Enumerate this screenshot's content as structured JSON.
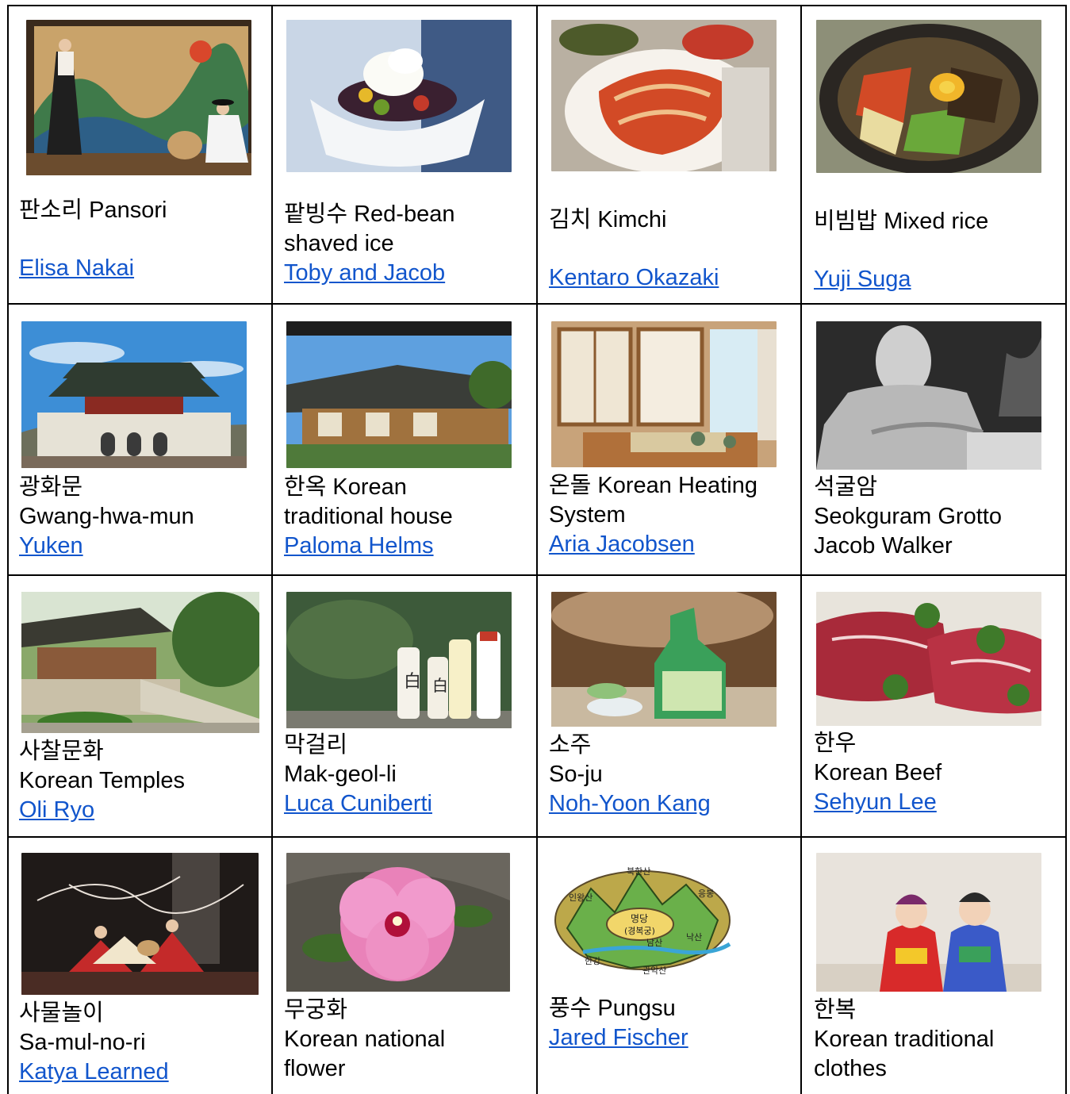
{
  "cells": [
    {
      "image": "pansori-performance-photo",
      "lines": [
        "판소리 Pansori"
      ],
      "credit": "Elisa Nakai",
      "credit_link": true
    },
    {
      "image": "patbingsu-dessert-photo",
      "lines": [
        "팥빙수 Red-bean",
        "shaved ice"
      ],
      "credit": "Toby and Jacob",
      "credit_link": true
    },
    {
      "image": "kimchi-plate-photo",
      "lines": [
        "김치  Kimchi"
      ],
      "credit": "Kentaro Okazaki",
      "credit_link": true
    },
    {
      "image": "bibimbap-bowl-photo",
      "lines": [
        "비빔밥 Mixed rice"
      ],
      "credit": "Yuji Suga",
      "credit_link": true
    },
    {
      "image": "gwanghwamun-gate-photo",
      "lines": [
        "광화문",
        "Gwang-hwa-mun"
      ],
      "credit": "Yuken",
      "credit_link": true
    },
    {
      "image": "hanok-house-photo",
      "lines": [
        "한옥 Korean",
        "traditional house"
      ],
      "credit": "Paloma Helms",
      "credit_link": true
    },
    {
      "image": "ondol-room-photo",
      "lines": [
        "온돌 Korean Heating",
        "System"
      ],
      "credit": "Aria Jacobsen",
      "credit_link": true
    },
    {
      "image": "seokguram-buddha-photo",
      "lines": [
        "석굴암",
        "Seokguram Grotto"
      ],
      "credit": "Jacob Walker",
      "credit_link": false
    },
    {
      "image": "korean-temple-photo",
      "lines": [
        "사찰문화",
        "Korean Temples"
      ],
      "credit": "Oli Ryo",
      "credit_link": true
    },
    {
      "image": "makgeolli-bottles-photo",
      "lines": [
        "막걸리",
        "Mak-geol-li"
      ],
      "credit": "Luca Cuniberti",
      "credit_link": true
    },
    {
      "image": "soju-bottle-photo",
      "lines": [
        "소주",
        "So-ju"
      ],
      "credit": "Noh-Yoon Kang",
      "credit_link": true
    },
    {
      "image": "hanwoo-beef-photo",
      "lines": [
        "한우",
        "Korean Beef"
      ],
      "credit": "Sehyun Lee",
      "credit_link": true
    },
    {
      "image": "samulnori-dancers-photo",
      "lines": [
        " 사물놀이",
        "Sa-mul-no-ri"
      ],
      "credit": "Katya Learned",
      "credit_link": true
    },
    {
      "image": "mugunghwa-flower-photo",
      "lines": [
        "무궁화",
        "Korean national",
        "flower"
      ],
      "credit": "",
      "credit_link": false
    },
    {
      "image": "pungsu-map-drawing",
      "lines": [
        "풍수 Pungsu"
      ],
      "credit": "Jared Fischer",
      "credit_link": true
    },
    {
      "image": "hanbok-babies-photo",
      "lines": [
        "한복",
        "Korean traditional",
        "clothes"
      ],
      "credit": "",
      "credit_link": false
    }
  ],
  "pungsu_map_labels": [
    "북한산",
    "인왕산",
    "명당",
    "(경복궁)",
    "낙산",
    "남산",
    "한강",
    "관악산",
    "응봉"
  ]
}
